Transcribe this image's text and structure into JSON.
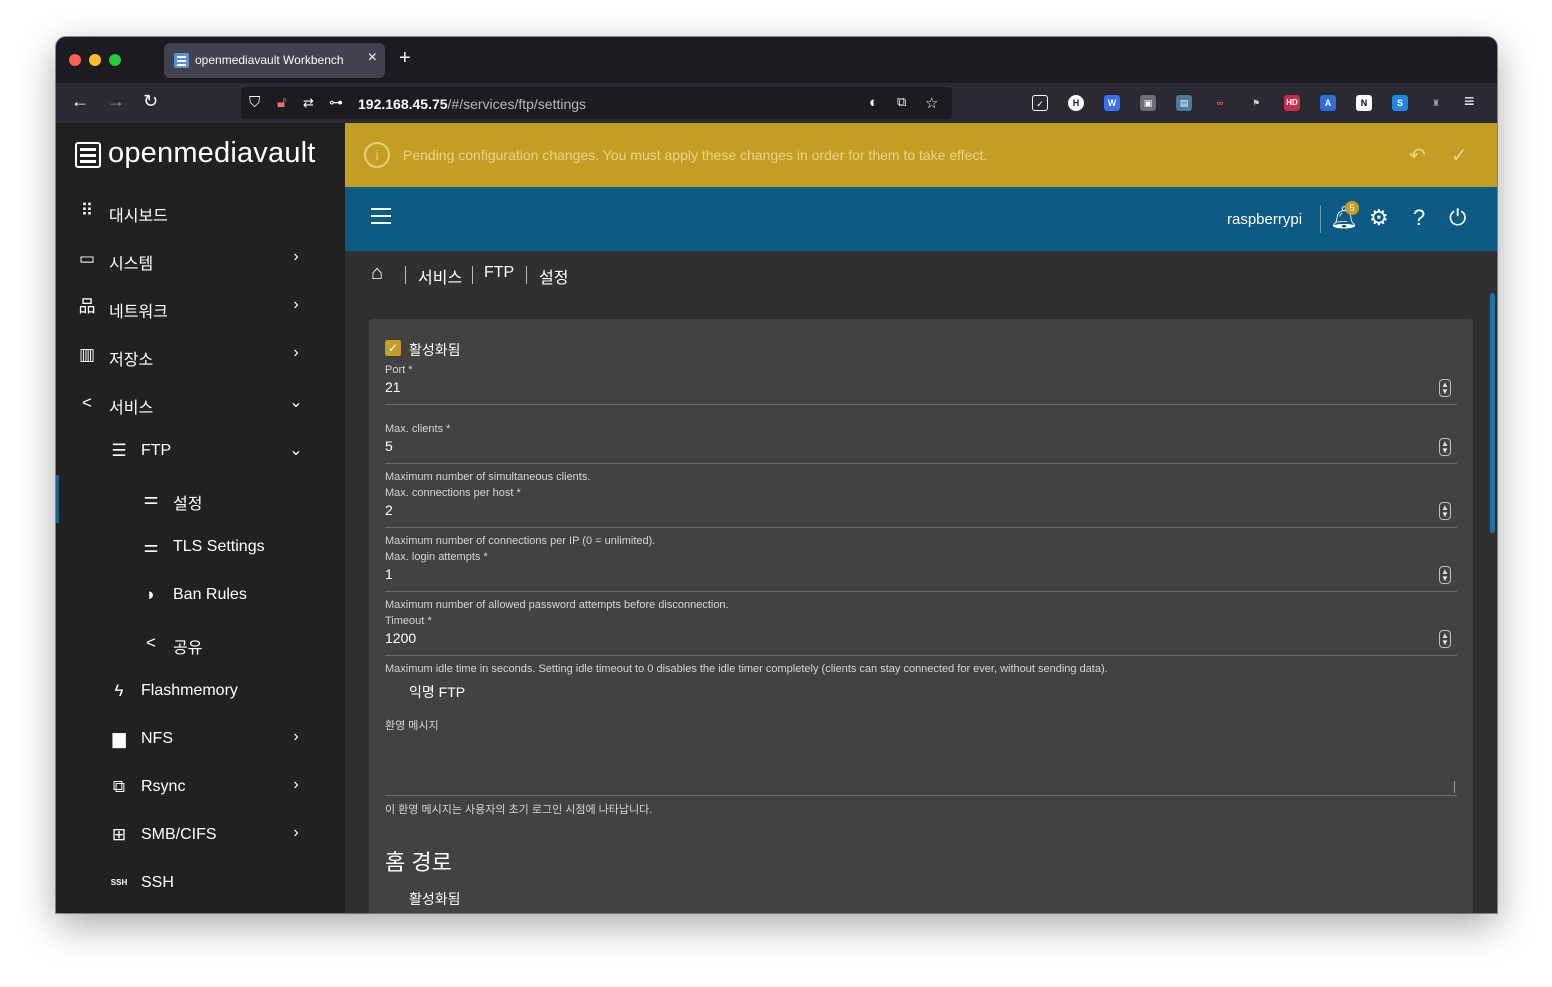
{
  "browser": {
    "tab_title": "openmediavault Workbench",
    "url_host": "192.168.45.75",
    "url_path": "/#/services/ftp/settings"
  },
  "sidebar": {
    "brand": "openmediavault",
    "items": [
      {
        "label": "대시보드",
        "icon": "grid-icon"
      },
      {
        "label": "시스템",
        "icon": "laptop-icon"
      },
      {
        "label": "네트워크",
        "icon": "network-icon"
      },
      {
        "label": "저장소",
        "icon": "storage-icon"
      },
      {
        "label": "서비스",
        "icon": "share-icon"
      },
      {
        "label": "FTP",
        "icon": "server-icon"
      },
      {
        "label": "설정",
        "icon": "sliders-icon"
      },
      {
        "label": "TLS Settings",
        "icon": "sliders-icon"
      },
      {
        "label": "Ban Rules",
        "icon": "shield-icon"
      },
      {
        "label": "공유",
        "icon": "share-icon"
      },
      {
        "label": "Flashmemory",
        "icon": "flash-icon"
      },
      {
        "label": "NFS",
        "icon": "folder-network-icon"
      },
      {
        "label": "Rsync",
        "icon": "rsync-icon"
      },
      {
        "label": "SMB/CIFS",
        "icon": "windows-icon"
      },
      {
        "label": "SSH",
        "icon": "ssh-icon"
      }
    ]
  },
  "pending": {
    "message": "Pending configuration changes. You must apply these changes in order for them to take effect."
  },
  "topbar": {
    "hostname": "raspberrypi",
    "notification_count": "5"
  },
  "breadcrumb": {
    "items": [
      "서비스",
      "FTP",
      "설정"
    ]
  },
  "form": {
    "enabled_label": "활성화됨",
    "port": {
      "label": "Port *",
      "value": "21"
    },
    "max_clients": {
      "label": "Max. clients *",
      "value": "5",
      "hint": "Maximum number of simultaneous clients."
    },
    "max_conn": {
      "label": "Max. connections per host *",
      "value": "2",
      "hint": "Maximum number of connections per IP (0 = unlimited)."
    },
    "max_login": {
      "label": "Max. login attempts *",
      "value": "1",
      "hint": "Maximum number of allowed password attempts before disconnection."
    },
    "timeout": {
      "label": "Timeout *",
      "value": "1200",
      "hint": "Maximum idle time in seconds. Setting idle timeout to 0 disables the idle timer completely (clients can stay connected for ever, without sending data)."
    },
    "anon_ftp_label": "익명 FTP",
    "welcome": {
      "label": "환영 메시지",
      "value": "",
      "hint": "이 환영 메시지는 사용자의 초기 로그인 시점에 나타납니다."
    },
    "home_section_title": "홈 경로",
    "home_enabled_label": "활성화됨"
  },
  "colors": {
    "accent": "#c39d24",
    "topbar": "#0d5b85",
    "sidebar": "#212121",
    "content": "#303030",
    "card": "#424242"
  }
}
